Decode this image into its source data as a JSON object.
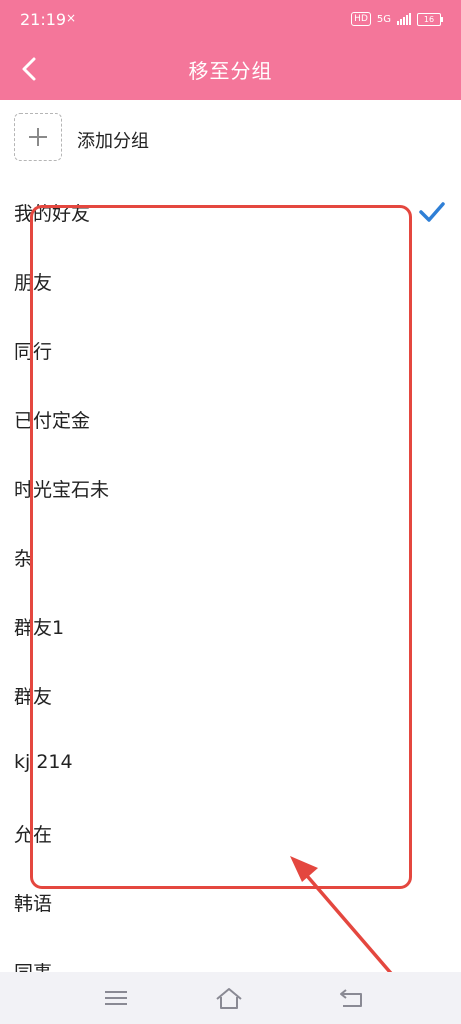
{
  "status_bar": {
    "time": "21:19",
    "notif_text": "×",
    "hd": "HD",
    "network": "5G",
    "battery": "16"
  },
  "header": {
    "title": "移至分组"
  },
  "add_group": {
    "label": "添加分组"
  },
  "groups": [
    {
      "label": "我的好友",
      "selected": true
    },
    {
      "label": "朋友",
      "selected": false
    },
    {
      "label": "同行",
      "selected": false
    },
    {
      "label": "已付定金",
      "selected": false
    },
    {
      "label": "时光宝石未",
      "selected": false
    },
    {
      "label": "杂",
      "selected": false
    },
    {
      "label": "群友1",
      "selected": false
    },
    {
      "label": "群友",
      "selected": false
    },
    {
      "label": "kj 214",
      "selected": false
    },
    {
      "label": "允在",
      "selected": false
    },
    {
      "label": "韩语",
      "selected": false
    },
    {
      "label": "同事",
      "selected": false
    }
  ],
  "colors": {
    "header_bg": "#f4769a",
    "check": "#2f7fd6",
    "annotation": "#e4473f"
  }
}
